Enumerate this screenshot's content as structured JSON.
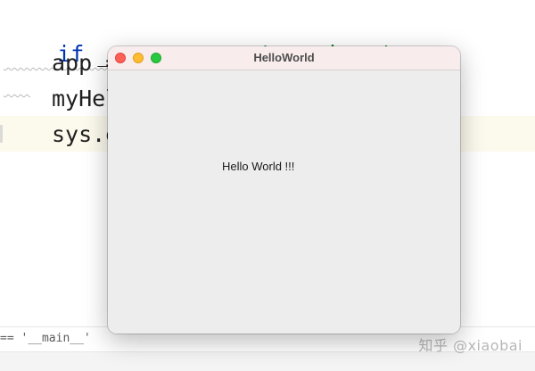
{
  "editor": {
    "line1": {
      "kw": "if",
      "mid": " __name__ == ",
      "str": "'__main__'",
      "end": ":"
    },
    "line2": "app =",
    "line3": "myHel",
    "line4": "sys.e"
  },
  "status": {
    "breadcrumb": "== '__main__'"
  },
  "app_window": {
    "title": "HelloWorld",
    "label_text": "Hello World !!!",
    "buttons": [
      "close",
      "minimize",
      "zoom"
    ]
  },
  "watermark": "知乎 @xiaobai",
  "colors": {
    "close": "#fe5f57",
    "minimize": "#febc2e",
    "zoom": "#28c840",
    "keyword": "#0033b3",
    "string": "#067d17"
  }
}
